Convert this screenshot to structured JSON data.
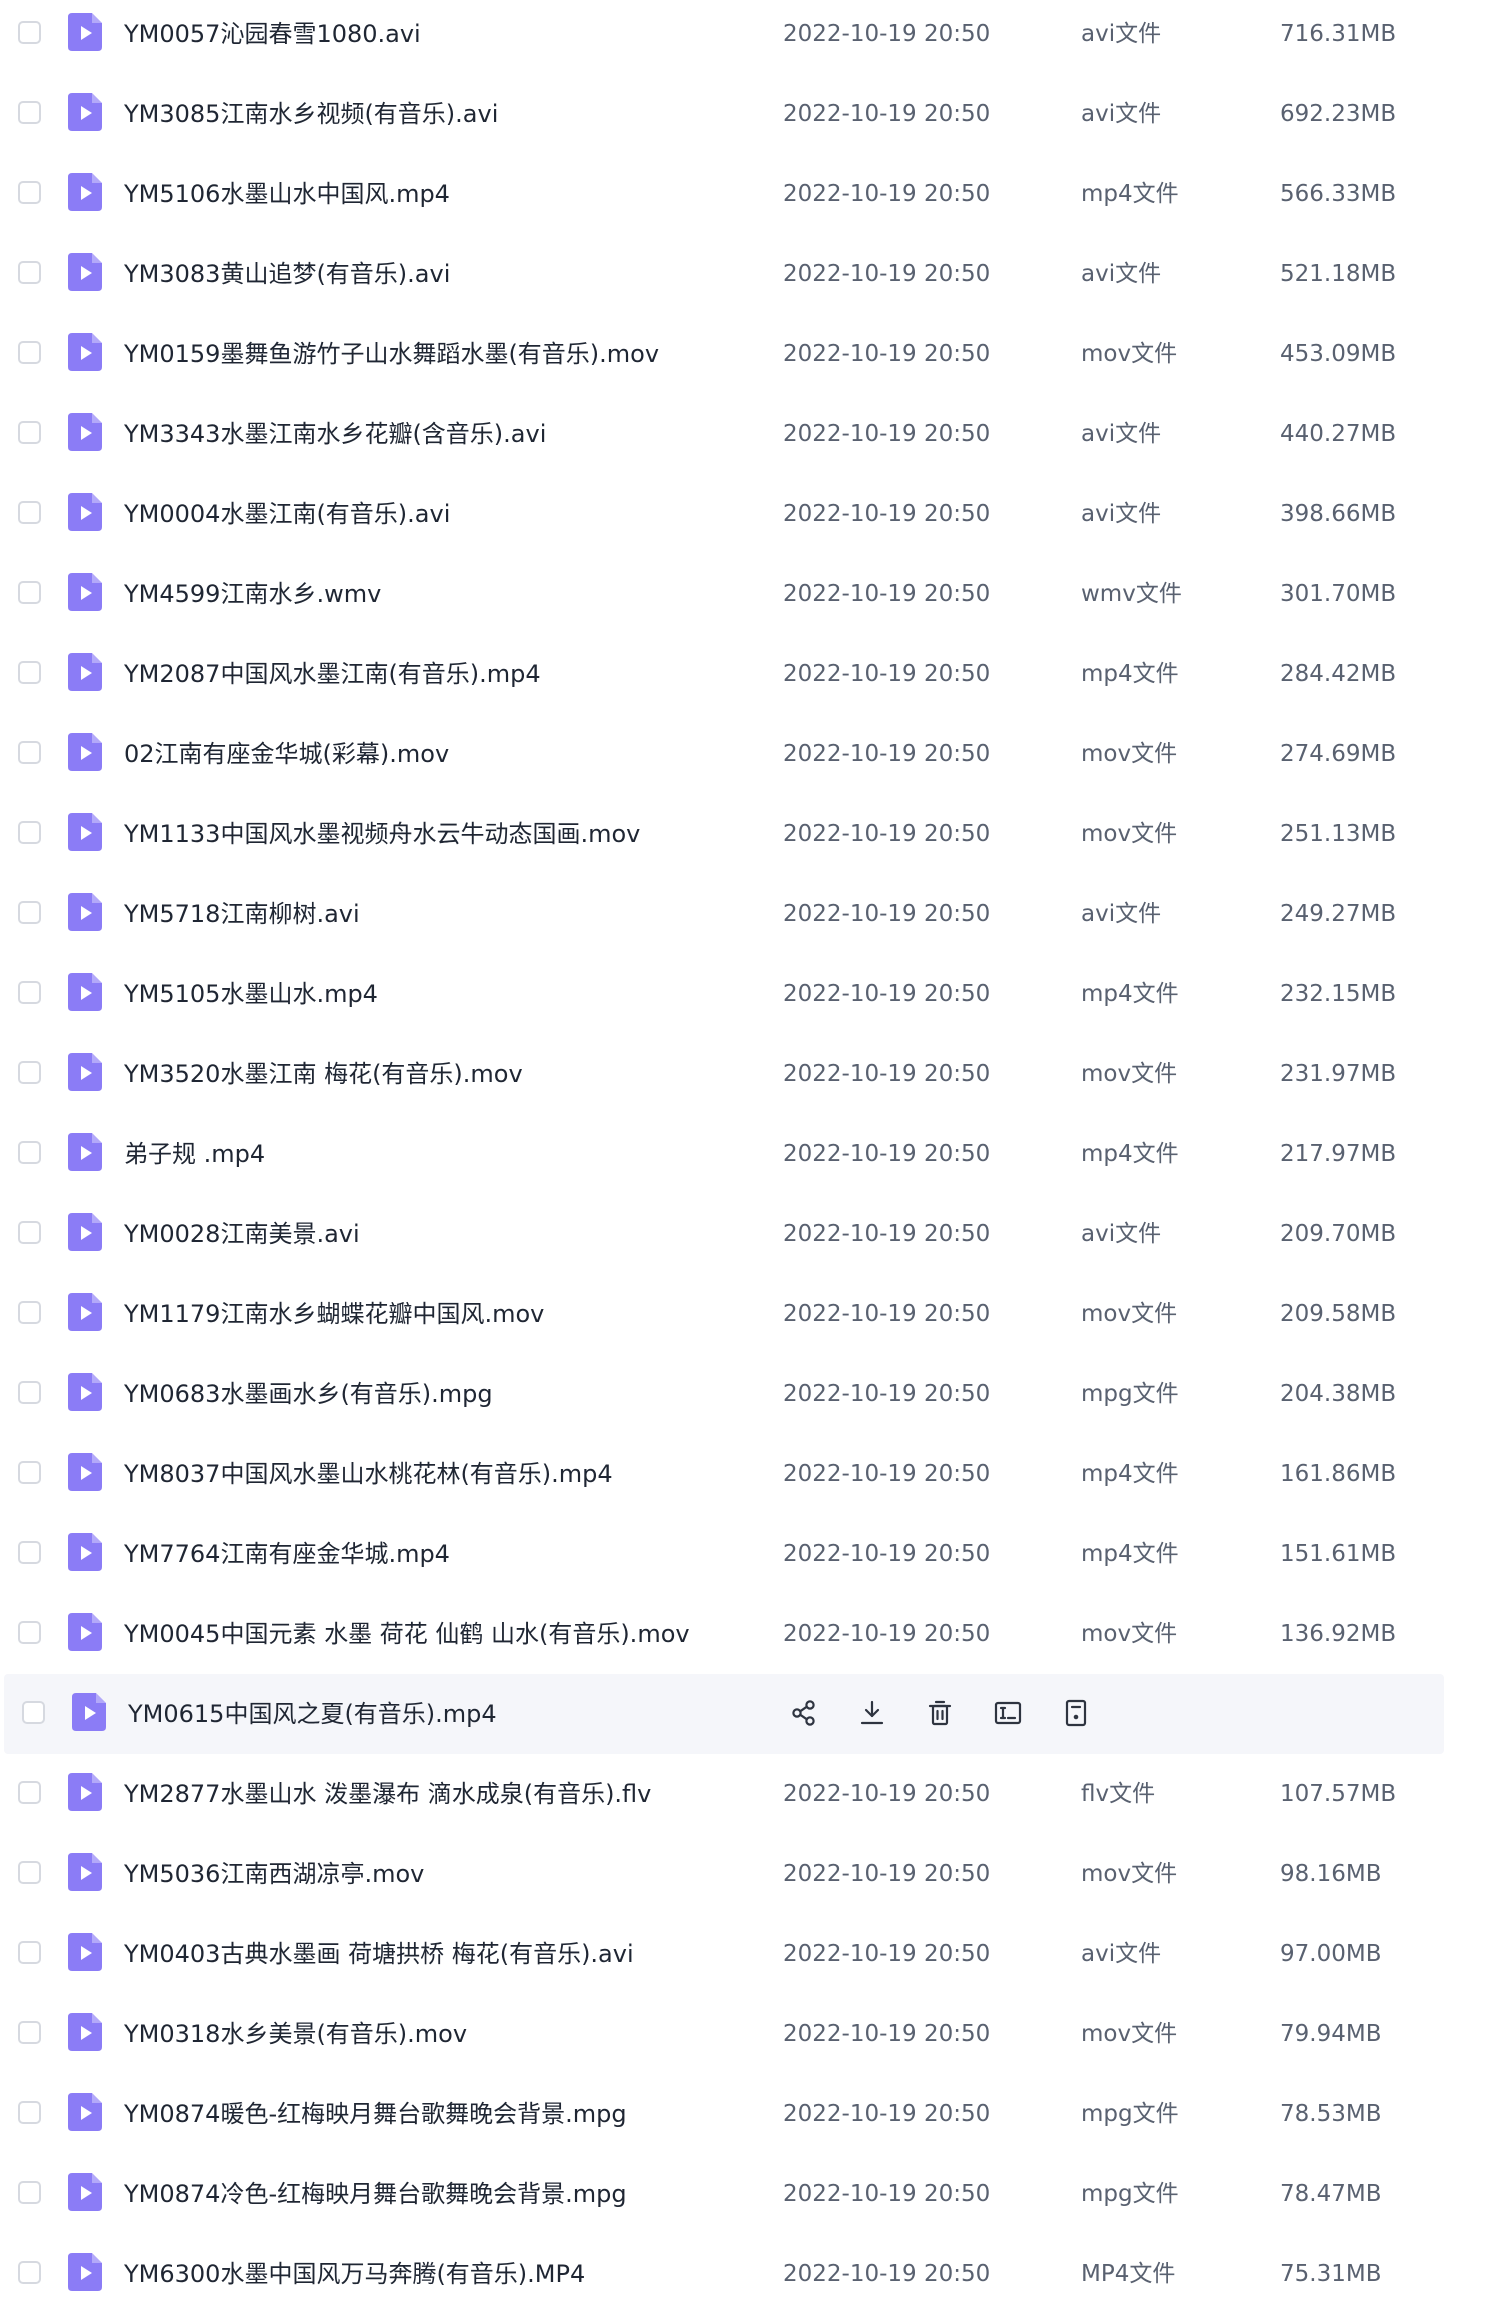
{
  "colors": {
    "file_icon": "#8b7cf6",
    "hover_row_background": "#f5f6fa",
    "text_primary": "#1f2633",
    "text_secondary": "#596170"
  },
  "row_actions": [
    {
      "name": "share-icon",
      "icon": "share-icon"
    },
    {
      "name": "download-icon",
      "icon": "download-icon"
    },
    {
      "name": "delete-icon",
      "icon": "trash-icon"
    },
    {
      "name": "rename-icon",
      "icon": "rename-icon"
    },
    {
      "name": "more-icon",
      "icon": "document-icon"
    }
  ],
  "files": [
    {
      "name": "YM0057沁园春雪1080.avi",
      "date": "2022-10-19 20:50",
      "type": "avi文件",
      "size": "716.31MB"
    },
    {
      "name": "YM3085江南水乡视频(有音乐).avi",
      "date": "2022-10-19 20:50",
      "type": "avi文件",
      "size": "692.23MB"
    },
    {
      "name": "YM5106水墨山水中国风.mp4",
      "date": "2022-10-19 20:50",
      "type": "mp4文件",
      "size": "566.33MB"
    },
    {
      "name": "YM3083黄山追梦(有音乐).avi",
      "date": "2022-10-19 20:50",
      "type": "avi文件",
      "size": "521.18MB"
    },
    {
      "name": "YM0159墨舞鱼游竹子山水舞蹈水墨(有音乐).mov",
      "date": "2022-10-19 20:50",
      "type": "mov文件",
      "size": "453.09MB"
    },
    {
      "name": "YM3343水墨江南水乡花瓣(含音乐).avi",
      "date": "2022-10-19 20:50",
      "type": "avi文件",
      "size": "440.27MB"
    },
    {
      "name": "YM0004水墨江南(有音乐).avi",
      "date": "2022-10-19 20:50",
      "type": "avi文件",
      "size": "398.66MB"
    },
    {
      "name": "YM4599江南水乡.wmv",
      "date": "2022-10-19 20:50",
      "type": "wmv文件",
      "size": "301.70MB"
    },
    {
      "name": "YM2087中国风水墨江南(有音乐).mp4",
      "date": "2022-10-19 20:50",
      "type": "mp4文件",
      "size": "284.42MB"
    },
    {
      "name": "02江南有座金华城(彩幕).mov",
      "date": "2022-10-19 20:50",
      "type": "mov文件",
      "size": "274.69MB"
    },
    {
      "name": "YM1133中国风水墨视频舟水云牛动态国画.mov",
      "date": "2022-10-19 20:50",
      "type": "mov文件",
      "size": "251.13MB"
    },
    {
      "name": "YM5718江南柳树.avi",
      "date": "2022-10-19 20:50",
      "type": "avi文件",
      "size": "249.27MB"
    },
    {
      "name": "YM5105水墨山水.mp4",
      "date": "2022-10-19 20:50",
      "type": "mp4文件",
      "size": "232.15MB"
    },
    {
      "name": "YM3520水墨江南 梅花(有音乐).mov",
      "date": "2022-10-19 20:50",
      "type": "mov文件",
      "size": "231.97MB"
    },
    {
      "name": "弟子规 .mp4",
      "date": "2022-10-19 20:50",
      "type": "mp4文件",
      "size": "217.97MB"
    },
    {
      "name": "YM0028江南美景.avi",
      "date": "2022-10-19 20:50",
      "type": "avi文件",
      "size": "209.70MB"
    },
    {
      "name": "YM1179江南水乡蝴蝶花瓣中国风.mov",
      "date": "2022-10-19 20:50",
      "type": "mov文件",
      "size": "209.58MB"
    },
    {
      "name": "YM0683水墨画水乡(有音乐).mpg",
      "date": "2022-10-19 20:50",
      "type": "mpg文件",
      "size": "204.38MB"
    },
    {
      "name": "YM8037中国风水墨山水桃花林(有音乐).mp4",
      "date": "2022-10-19 20:50",
      "type": "mp4文件",
      "size": "161.86MB"
    },
    {
      "name": "YM7764江南有座金华城.mp4",
      "date": "2022-10-19 20:50",
      "type": "mp4文件",
      "size": "151.61MB"
    },
    {
      "name": "YM0045中国元素 水墨 荷花 仙鹤 山水(有音乐).mov",
      "date": "2022-10-19 20:50",
      "type": "mov文件",
      "size": "136.92MB"
    },
    {
      "name": "YM0615中国风之夏(有音乐).mp4",
      "date": "",
      "type": "",
      "size": "",
      "hovered": true
    },
    {
      "name": "YM2877水墨山水 泼墨瀑布 滴水成泉(有音乐).flv",
      "date": "2022-10-19 20:50",
      "type": "flv文件",
      "size": "107.57MB"
    },
    {
      "name": "YM5036江南西湖凉亭.mov",
      "date": "2022-10-19 20:50",
      "type": "mov文件",
      "size": "98.16MB"
    },
    {
      "name": "YM0403古典水墨画 荷塘拱桥 梅花(有音乐).avi",
      "date": "2022-10-19 20:50",
      "type": "avi文件",
      "size": "97.00MB"
    },
    {
      "name": "YM0318水乡美景(有音乐).mov",
      "date": "2022-10-19 20:50",
      "type": "mov文件",
      "size": "79.94MB"
    },
    {
      "name": "YM0874暖色-红梅映月舞台歌舞晚会背景.mpg",
      "date": "2022-10-19 20:50",
      "type": "mpg文件",
      "size": "78.53MB"
    },
    {
      "name": "YM0874冷色-红梅映月舞台歌舞晚会背景.mpg",
      "date": "2022-10-19 20:50",
      "type": "mpg文件",
      "size": "78.47MB"
    },
    {
      "name": "YM6300水墨中国风万马奔腾(有音乐).MP4",
      "date": "2022-10-19 20:50",
      "type": "MP4文件",
      "size": "75.31MB"
    }
  ]
}
